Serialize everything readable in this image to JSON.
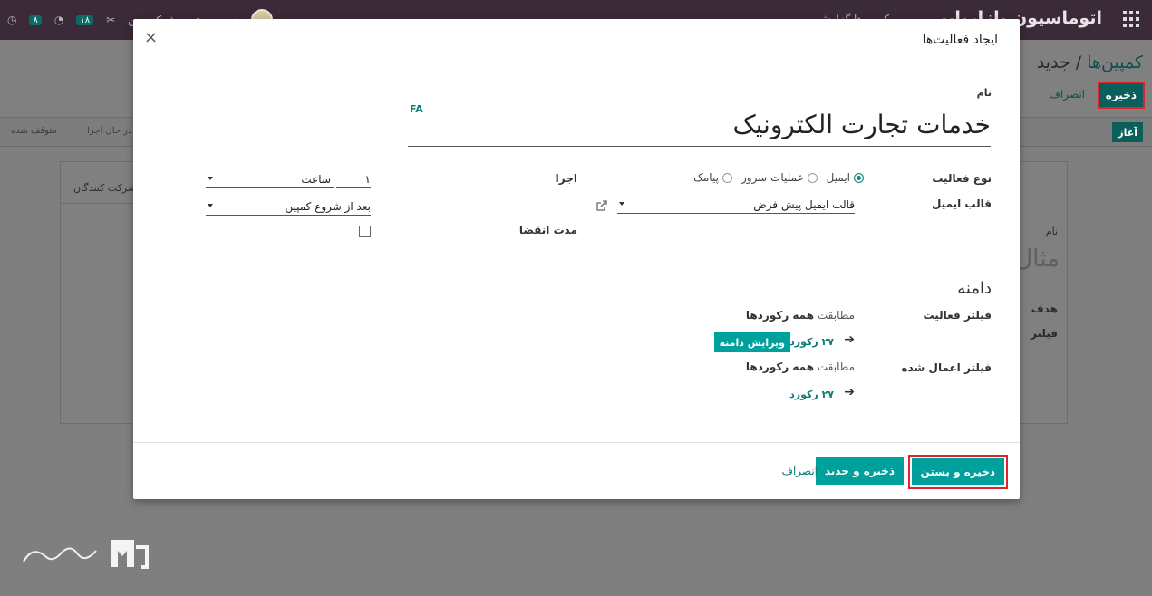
{
  "topbar": {
    "app_title": "اتوماسیون بازاریابی",
    "menu_items": "کمپین‌ها   گزارش",
    "user_name": "مدیر سیستم",
    "company": "شرکت من",
    "badge_messages": "۱۸",
    "badge_activities": "۸"
  },
  "control_panel": {
    "breadcrumb_parent": "کمپین‌ها",
    "breadcrumb_sep": "/",
    "breadcrumb_current": "جدید",
    "save_label": "ذخیره",
    "discard_label": "انصراف"
  },
  "statusbar": {
    "start_label": "آغاز",
    "stages": [
      "در حال اجرا",
      "متوقف شده"
    ]
  },
  "sheet": {
    "tab_label": "شرکت کنندگان",
    "name_label": "نام",
    "name_placeholder": "مثال",
    "target_label": "هدف",
    "filter_label": "فیلتر"
  },
  "modal": {
    "title": "ایجاد فعالیت‌ها",
    "close": "×",
    "name_label": "نام",
    "name_value": "خدمات تجارت الکترونیک",
    "lang_badge": "FA",
    "activity_type_label": "نوع فعالیت",
    "activity_types": [
      {
        "label": "ایمیل",
        "selected": true
      },
      {
        "label": "عملیات سرور",
        "selected": false
      },
      {
        "label": "پیامک",
        "selected": false
      }
    ],
    "email_template_label": "قالب ایمیل",
    "email_template_value": "قالب ایمیل پیش فرض",
    "execute_label": "اجرا",
    "interval_number": "۱",
    "interval_unit": "ساعت",
    "trigger_value": "بعد از شروع کمپین",
    "expiry_label": "مدت انقضا",
    "expiry_checked": false,
    "domain_heading": "دامنه",
    "activity_filter_label": "فیلتر فعالیت",
    "applied_filter_label": "فیلتر اعمال شده",
    "match_prefix": "مطابقت",
    "match_all": "همه رکوردها",
    "record_count_1": "۲۷ رکورد",
    "record_count_2": "۲۷ رکورد",
    "edit_domain_label": "ویرایش دامنه",
    "save_close_label": "ذخیره و بستن",
    "save_new_label": "ذخیره و جدید",
    "discard_label": "انصراف"
  },
  "colors": {
    "primary": "#00a09d",
    "highlight": "#e0242c",
    "topbar": "#3b2a38"
  }
}
